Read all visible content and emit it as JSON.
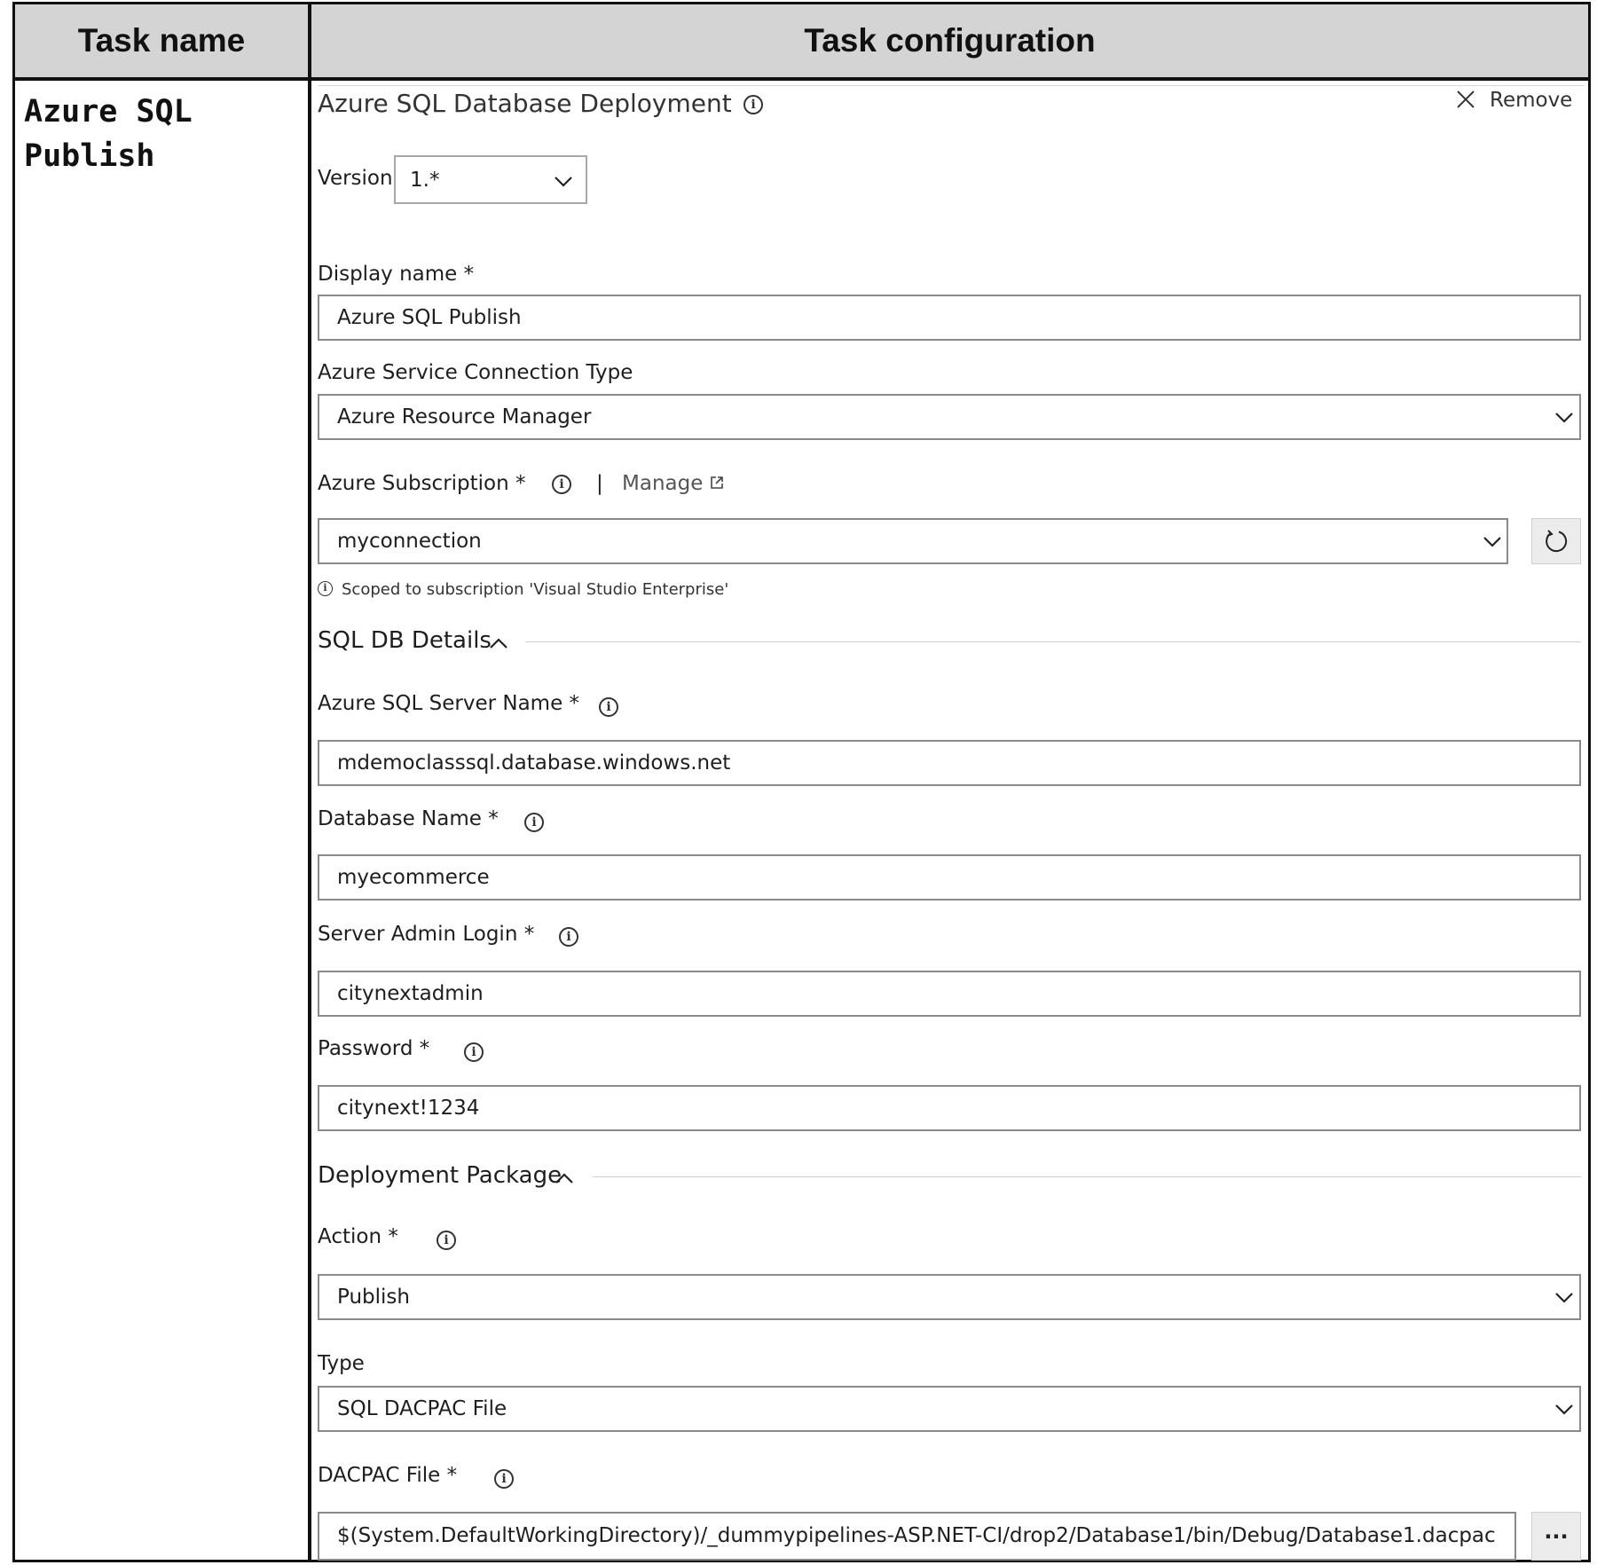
{
  "table": {
    "col1_header": "Task name",
    "col2_header": "Task configuration"
  },
  "task": {
    "name_line1": "Azure SQL",
    "name_line2": "Publish"
  },
  "config": {
    "title": "Azure SQL Database Deployment",
    "remove_label": "Remove",
    "version_label": "Version",
    "version_value": "1.*",
    "display_name_label": "Display name *",
    "display_name_value": "Azure SQL Publish",
    "connection_type_label": "Azure Service Connection Type",
    "connection_type_value": "Azure Resource Manager",
    "subscription_label": "Azure Subscription *",
    "separator": "|",
    "manage_label": "Manage",
    "subscription_value": "myconnection",
    "scope_note": "Scoped to subscription 'Visual Studio Enterprise'",
    "sql_section_title": "SQL DB Details",
    "server_name_label": "Azure SQL Server Name *",
    "server_name_value": "mdemoclasssql.database.windows.net",
    "database_name_label": "Database Name *",
    "database_name_value": "myecommerce",
    "admin_login_label": "Server Admin Login *",
    "admin_login_value": "citynextadmin",
    "password_label": "Password *",
    "password_value": "citynext!1234",
    "deploy_section_title": "Deployment Package",
    "action_label": "Action *",
    "action_value": "Publish",
    "type_label": "Type",
    "type_value": "SQL DACPAC File",
    "dacpac_label": "DACPAC File *",
    "dacpac_value": "$(System.DefaultWorkingDirectory)/_dummypipelines-ASP.NET-CI/drop2/Database1/bin/Debug/Database1.dacpac",
    "browse_label": "···"
  },
  "icons": {
    "info": "info-icon",
    "close": "close-icon",
    "chevron_down": "chevron-down-icon",
    "chevron_up": "chevron-up-icon",
    "external_link": "external-link-icon",
    "refresh": "refresh-icon"
  }
}
